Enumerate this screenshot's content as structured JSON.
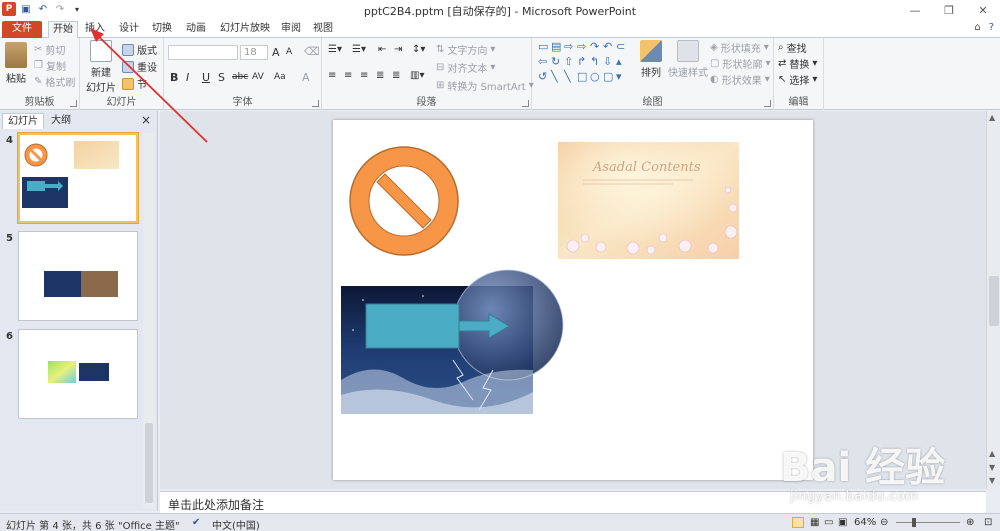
{
  "window": {
    "title": "pptC2B4.pptm [自动保存的] - Microsoft PowerPoint",
    "logo_letter": "P",
    "controls": [
      "—",
      "❐",
      "✕"
    ]
  },
  "quick_access": [
    "save-icon",
    "undo-icon",
    "redo-icon",
    "customize-icon"
  ],
  "tabs": [
    "文件",
    "开始",
    "插入",
    "设计",
    "切换",
    "动画",
    "幻灯片放映",
    "审阅",
    "视图"
  ],
  "active_tab": "开始",
  "ribbon": {
    "clipboard": {
      "label": "剪贴板",
      "paste": "粘贴",
      "cut": "剪切",
      "copy": "复制",
      "format_painter": "格式刷"
    },
    "slides": {
      "label": "幻灯片",
      "new_slide_line1": "新建",
      "new_slide_line2": "幻灯片",
      "layout": "版式",
      "reset": "重设",
      "section": "节"
    },
    "font": {
      "label": "字体",
      "font_name": "",
      "font_size": "18",
      "buttons": [
        "B",
        "I",
        "U",
        "S",
        "abc",
        "AV",
        "Aa",
        "A"
      ],
      "grow": "A",
      "shrink": "A",
      "clear": "⌫"
    },
    "paragraph": {
      "label": "段落",
      "text_direction": "文字方向",
      "align_text": "对齐文本",
      "smartart": "转换为 SmartArt"
    },
    "drawing": {
      "label": "绘图",
      "arrange": "排列",
      "quick_styles": "快速样式",
      "fill": "形状填充",
      "outline": "形状轮廓",
      "effects": "形状效果"
    },
    "editing": {
      "label": "编辑",
      "find": "查找",
      "replace": "替换",
      "select": "选择"
    }
  },
  "left_panel": {
    "tabs": [
      "幻灯片",
      "大纲"
    ],
    "close": "×",
    "slides": [
      {
        "number": "4",
        "selected": true
      },
      {
        "number": "5",
        "selected": false
      },
      {
        "number": "6",
        "selected": false
      }
    ]
  },
  "slide": {
    "image_text": "Asadal Contents"
  },
  "notes_placeholder": "单击此处添加备注",
  "status": {
    "slide_info": "幻灯片 第 4 张，共 6 张",
    "theme": "\"Office 主题\"",
    "language": "中文(中国)",
    "zoom": "64%"
  },
  "watermark": {
    "text": "Bai 经验",
    "url": "jingyan.baidu.com"
  },
  "colors": {
    "file_tab": "#d24726",
    "no_symbol_fill": "#f79646",
    "no_symbol_stroke": "#b66d2e",
    "shape_fill": "#4bacc6",
    "annotation_arrow": "#e03131"
  }
}
